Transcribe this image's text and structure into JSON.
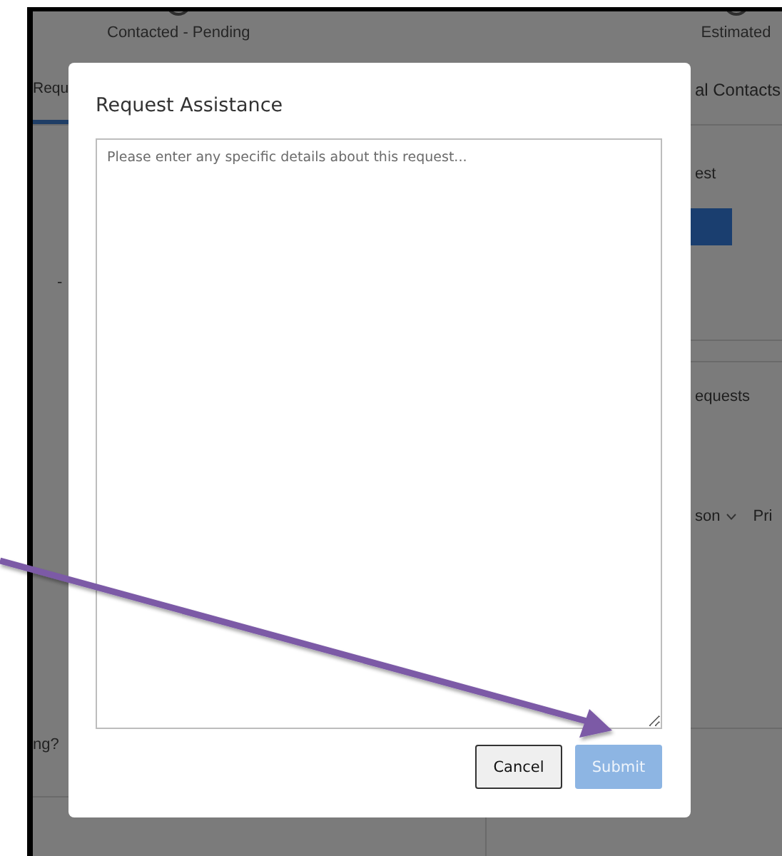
{
  "background": {
    "steps": [
      {
        "label": "Contacted - Pending"
      },
      {
        "label": "Estimated"
      }
    ],
    "tabs": [
      {
        "label": "Requ",
        "selected": true
      },
      {
        "label": "al Contacts",
        "selected": false
      }
    ],
    "left_panel": {
      "text_1": "-",
      "text_2": "ng?"
    },
    "right_panel": {
      "card_1_title": "est",
      "card_2_title": "equests",
      "columns": [
        {
          "label": "son",
          "sortable": true
        },
        {
          "label": "Pri",
          "sortable": false
        }
      ]
    }
  },
  "dialog": {
    "title": "Request Assistance",
    "details": {
      "placeholder": "Please enter any specific details about this request..."
    },
    "buttons": [
      {
        "label": "Cancel",
        "kind": "secondary",
        "disabled": false
      },
      {
        "label": "Submit",
        "kind": "primary",
        "disabled": true
      }
    ]
  }
}
